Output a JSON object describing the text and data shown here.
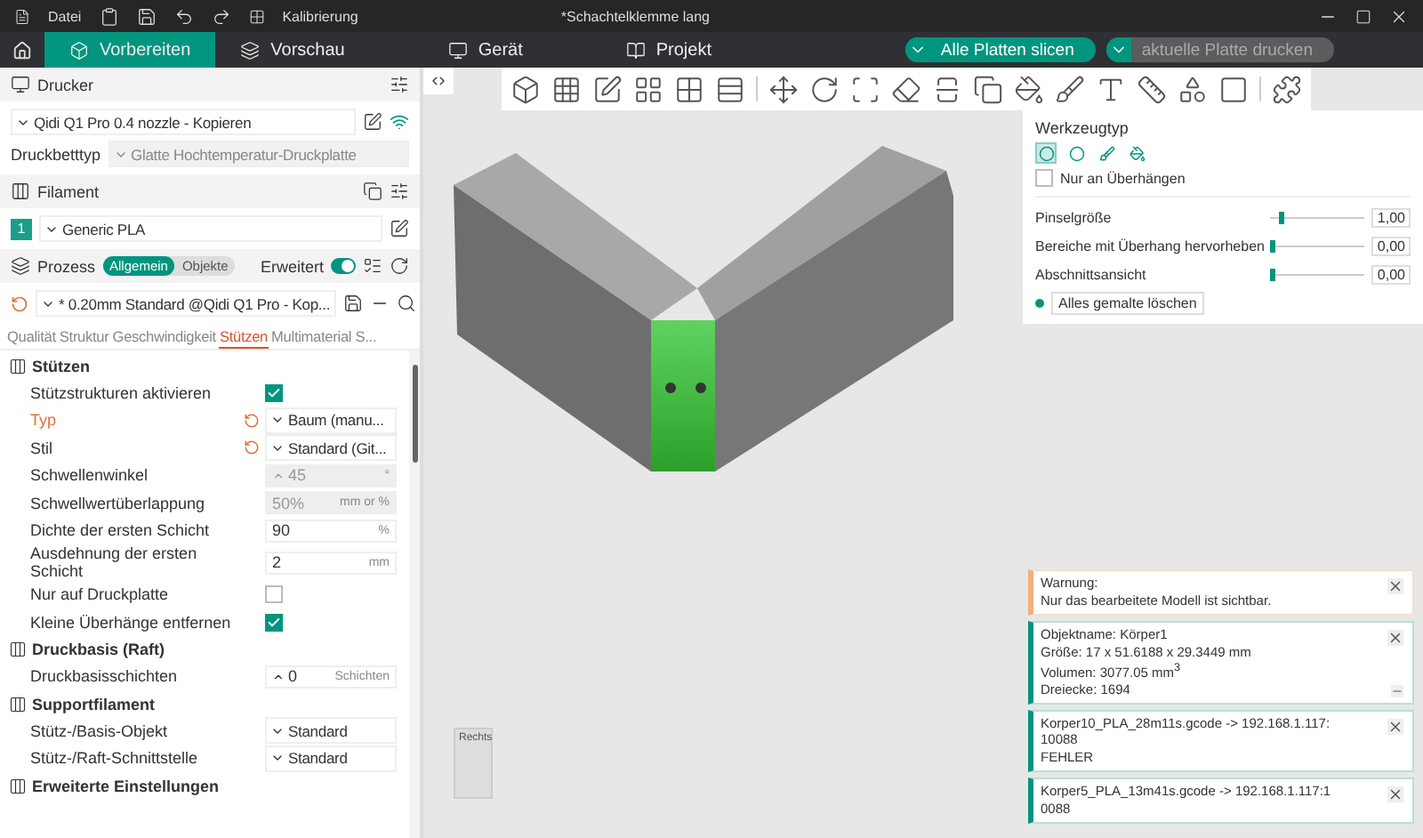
{
  "title_bar": {
    "menu": "Datei",
    "calibration": "Kalibrierung",
    "document_title": "*Schachtelklemme lang"
  },
  "tabs": [
    {
      "label": "Vorbereiten",
      "selected": true
    },
    {
      "label": "Vorschau",
      "selected": false
    },
    {
      "label": "Gerät",
      "selected": false
    },
    {
      "label": "Projekt",
      "selected": false
    }
  ],
  "actions": {
    "slice": "Alle Platten slicen",
    "print": "aktuelle Platte drucken",
    "print_disabled": true
  },
  "printer": {
    "header": "Drucker",
    "name": "Qidi Q1 Pro 0.4 nozzle - Kopieren",
    "bed_label": "Druckbetttyp",
    "bed_value": "Glatte Hochtemperatur-Druckplatte"
  },
  "filament": {
    "header": "Filament",
    "items": [
      {
        "index": "1",
        "name": "Generic PLA",
        "color": "#1a9e8a"
      }
    ]
  },
  "process": {
    "header": "Prozess",
    "modes": [
      {
        "label": "Allgemein",
        "selected": true
      },
      {
        "label": "Objekte",
        "selected": false
      }
    ],
    "advanced_label": "Erweitert",
    "advanced_on": true,
    "preset": "* 0.20mm Standard @Qidi Q1 Pro - Kop...",
    "tabs": [
      {
        "label": "Qualität",
        "selected": false
      },
      {
        "label": "Struktur",
        "selected": false
      },
      {
        "label": "Geschwindigkeit",
        "selected": false
      },
      {
        "label": "Stützen",
        "selected": true
      },
      {
        "label": "Multimaterial S...",
        "selected": false
      }
    ]
  },
  "sections": [
    {
      "title": "Stützen",
      "rows": [
        {
          "kind": "checkbox",
          "label": "Stützstrukturen aktivieren",
          "checked": true
        },
        {
          "kind": "select",
          "label": "Typ",
          "value": "Baum (manu...",
          "modified": true,
          "resettable": true
        },
        {
          "kind": "select",
          "label": "Stil",
          "value": "Standard (Git...",
          "modified": false,
          "resettable": true
        },
        {
          "kind": "number",
          "label": "Schwellenwinkel",
          "value": "45",
          "unit": "°",
          "disabled": true,
          "spinner": true
        },
        {
          "kind": "number",
          "label": "Schwellwertüberlappung",
          "value": "50%",
          "unit": "mm or %",
          "disabled": true
        },
        {
          "kind": "number",
          "label": "Dichte der ersten Schicht",
          "value": "90",
          "unit": "%",
          "disabled": false
        },
        {
          "kind": "number",
          "label": "Ausdehnung der ersten Schicht",
          "value": "2",
          "unit": "mm",
          "disabled": false
        },
        {
          "kind": "checkbox",
          "label": "Nur auf Druckplatte",
          "checked": false
        },
        {
          "kind": "checkbox",
          "label": "Kleine Überhänge entfernen",
          "checked": true
        }
      ]
    },
    {
      "title": "Druckbasis (Raft)",
      "rows": [
        {
          "kind": "number",
          "label": "Druckbasisschichten",
          "value": "0",
          "unit": "Schichten",
          "disabled": false,
          "spinner": true
        }
      ]
    },
    {
      "title": "Supportfilament",
      "rows": [
        {
          "kind": "select",
          "label": "Stütz-/Basis-Objekt",
          "value": "Standard",
          "modified": false
        },
        {
          "kind": "select",
          "label": "Stütz-/Raft-Schnittstelle",
          "value": "Standard",
          "modified": false
        }
      ]
    },
    {
      "title": "Erweiterte Einstellungen"
    }
  ],
  "paint_panel": {
    "title": "Werkzeugtyp",
    "tools": [
      {
        "selected": true
      },
      {
        "selected": false
      },
      {
        "selected": false
      },
      {
        "selected": false
      }
    ],
    "overhang_only": {
      "label": "Nur an Überhängen",
      "checked": false
    },
    "sliders": [
      {
        "label": "Pinselgröße",
        "level": 0.1,
        "reading": "1,00"
      },
      {
        "label": "Bereiche mit Überhang hervorheben",
        "level": 0,
        "reading": "0,00"
      },
      {
        "label": "Abschnittsansicht",
        "level": 0,
        "reading": "0,00"
      }
    ],
    "clear_button": "Alles gemalte löschen"
  },
  "view_cube": {
    "label": "Rechts"
  },
  "notifications": [
    {
      "kind": "warning",
      "lines": [
        "Warnung:",
        "Nur das bearbeitete Modell ist sichtbar."
      ],
      "collapsible": false
    },
    {
      "kind": "info",
      "lines": [
        "Objektname: Körper1",
        "Größe: 17 x 51.6188 x 29.3449 mm",
        "Volumen: 3077.05 mm$^{3}$",
        "Dreiecke: 1694"
      ],
      "collapsible": true
    },
    {
      "kind": "info",
      "lines": [
        "Korper10_PLA_28m11s.gcode -> 192.168.1.117:",
        "10088",
        "FEHLER"
      ],
      "collapsible": false
    },
    {
      "kind": "info",
      "lines": [
        "Korper5_PLA_13m41s.gcode -> 192.168.1.117:1",
        "0088"
      ],
      "collapsible": false
    }
  ]
}
